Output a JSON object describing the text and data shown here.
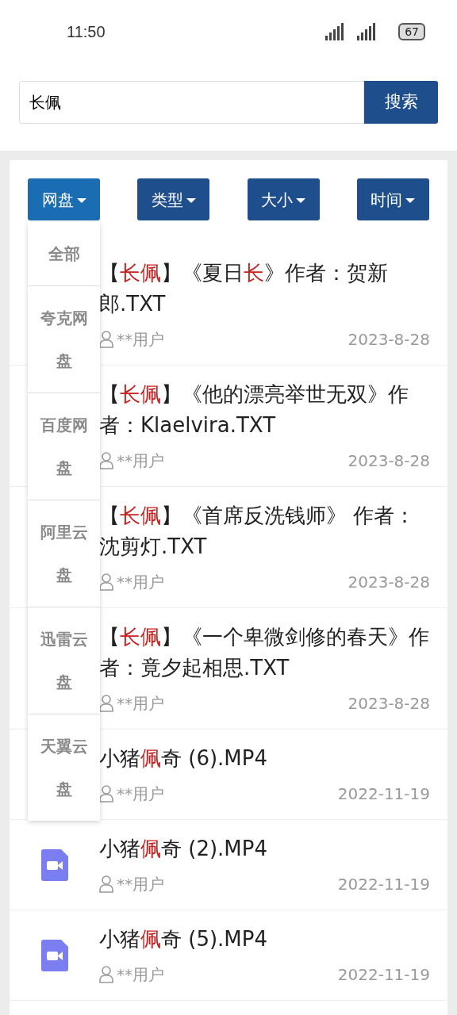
{
  "status_bar": {
    "time": "11:50",
    "battery": "67"
  },
  "search": {
    "value": "长佩",
    "button": "搜索"
  },
  "filters": [
    {
      "label": "网盘",
      "selected": true
    },
    {
      "label": "类型",
      "selected": false
    },
    {
      "label": "大小",
      "selected": false
    },
    {
      "label": "时间",
      "selected": false
    }
  ],
  "dropdown": {
    "items": [
      "全部",
      "夸克网盘",
      "百度网盘",
      "阿里云盘",
      "迅雷云盘",
      "天翼云盘"
    ]
  },
  "results": [
    {
      "title": [
        {
          "text": "【",
          "highlight": false
        },
        {
          "text": "长佩",
          "highlight": true
        },
        {
          "text": "】《夏日",
          "highlight": false
        },
        {
          "text": "长",
          "highlight": true
        },
        {
          "text": "》作者：贺新郎.TXT",
          "highlight": false
        }
      ],
      "user": "**用户",
      "date": "2023-8-28"
    },
    {
      "title": [
        {
          "text": "【",
          "highlight": false
        },
        {
          "text": "长佩",
          "highlight": true
        },
        {
          "text": "】《他的漂亮举世无双》作者：Klaelvira.TXT",
          "highlight": false
        }
      ],
      "user": "**用户",
      "date": "2023-8-28"
    },
    {
      "title": [
        {
          "text": "【",
          "highlight": false
        },
        {
          "text": "长佩",
          "highlight": true
        },
        {
          "text": "】《首席反洗钱师》 作者：沈剪灯.TXT",
          "highlight": false
        }
      ],
      "user": "**用户",
      "date": "2023-8-28"
    },
    {
      "title": [
        {
          "text": "【",
          "highlight": false
        },
        {
          "text": "长佩",
          "highlight": true
        },
        {
          "text": "】《一个卑微剑修的春天》作者：竟夕起相思.TXT",
          "highlight": false
        }
      ],
      "user": "**用户",
      "date": "2023-8-28"
    },
    {
      "title": [
        {
          "text": "小猪",
          "highlight": false
        },
        {
          "text": "佩",
          "highlight": true
        },
        {
          "text": "奇 (6).MP4",
          "highlight": false
        }
      ],
      "user": "**用户",
      "date": "2022-11-19"
    },
    {
      "kind": "video",
      "title": [
        {
          "text": "小猪",
          "highlight": false
        },
        {
          "text": "佩",
          "highlight": true
        },
        {
          "text": "奇 (2).MP4",
          "highlight": false
        }
      ],
      "user": "**用户",
      "date": "2022-11-19"
    },
    {
      "kind": "video",
      "title": [
        {
          "text": "小猪",
          "highlight": false
        },
        {
          "text": "佩",
          "highlight": true
        },
        {
          "text": "奇 (5).MP4",
          "highlight": false
        }
      ],
      "user": "**用户",
      "date": "2022-11-19"
    }
  ]
}
